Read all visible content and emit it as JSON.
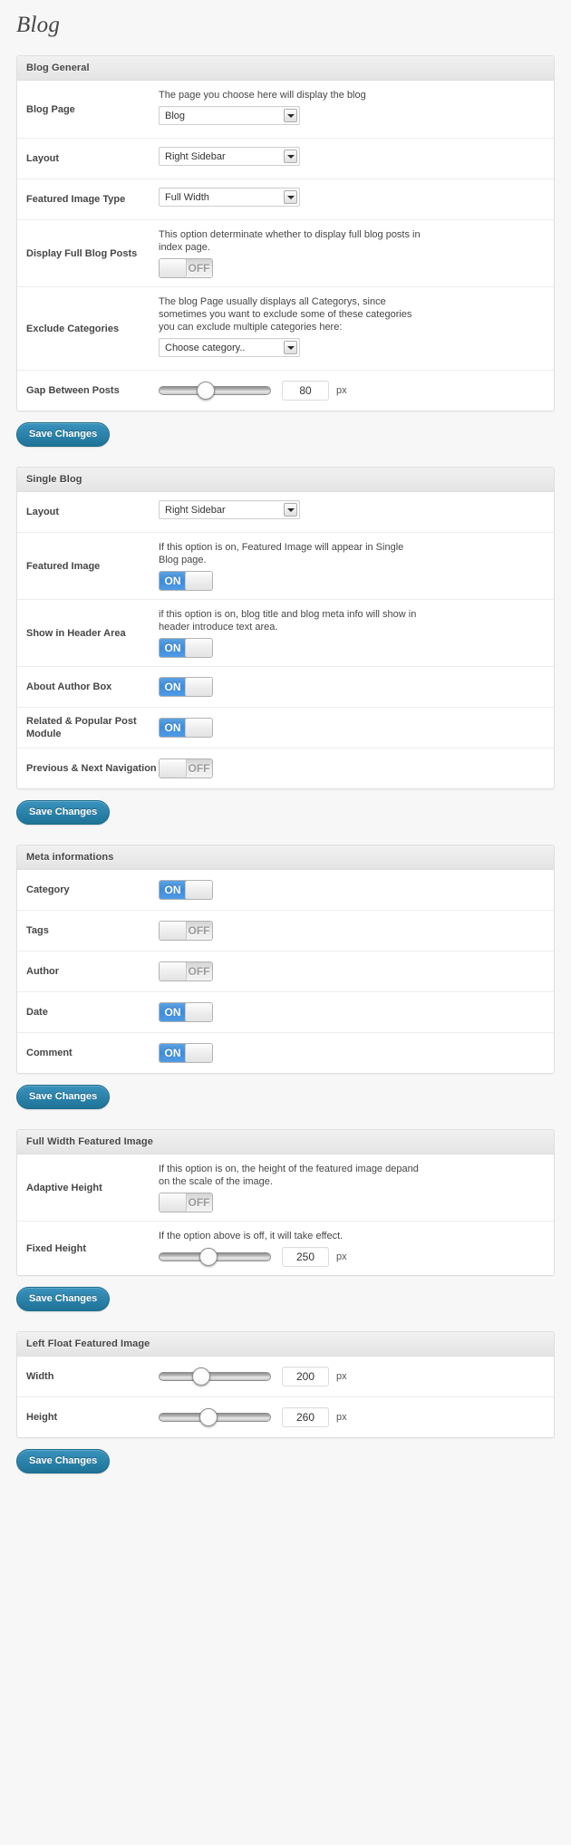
{
  "page": {
    "title": "Blog"
  },
  "save_label": "Save Changes",
  "units": {
    "px": "px"
  },
  "sections": [
    {
      "id": "blog-general",
      "header": "Blog General",
      "rows": [
        {
          "label": "Blog Page",
          "desc": "The page you choose here will display the blog",
          "control": "select",
          "value": "Blog"
        },
        {
          "label": "Layout",
          "desc": "",
          "control": "select",
          "value": "Right Sidebar"
        },
        {
          "label": "Featured Image Type",
          "desc": "",
          "control": "select",
          "value": "Full Width"
        },
        {
          "label": "Display Full Blog Posts",
          "desc": "This option determinate whether to display full blog posts in index page.",
          "control": "toggle",
          "state": "OFF"
        },
        {
          "label": "Exclude Categories",
          "desc": "The blog Page usually displays all Categorys, since sometimes you want to exclude some of these categories you can exclude multiple categories here:",
          "control": "select",
          "value": "Choose category.."
        },
        {
          "label": "Gap Between Posts",
          "desc": "",
          "control": "slider",
          "value": "80",
          "unit": "px",
          "percent": 42
        }
      ]
    },
    {
      "id": "single-blog",
      "header": "Single Blog",
      "rows": [
        {
          "label": "Layout",
          "desc": "",
          "control": "select",
          "value": "Right Sidebar"
        },
        {
          "label": "Featured Image",
          "desc": "If this option is on, Featured Image will appear in Single Blog page.",
          "control": "toggle",
          "state": "ON"
        },
        {
          "label": "Show in Header Area",
          "desc": "if this option is on, blog title and blog meta info will show in header introduce text area.",
          "control": "toggle",
          "state": "ON"
        },
        {
          "label": "About Author Box",
          "desc": "",
          "control": "toggle",
          "state": "ON"
        },
        {
          "label": "Related & Popular Post Module",
          "desc": "",
          "control": "toggle",
          "state": "ON"
        },
        {
          "label": "Previous & Next Navigation",
          "desc": "",
          "control": "toggle",
          "state": "OFF"
        }
      ]
    },
    {
      "id": "meta-informations",
      "header": "Meta informations",
      "rows": [
        {
          "label": "Category",
          "desc": "",
          "control": "toggle",
          "state": "ON"
        },
        {
          "label": "Tags",
          "desc": "",
          "control": "toggle",
          "state": "OFF"
        },
        {
          "label": "Author",
          "desc": "",
          "control": "toggle",
          "state": "OFF"
        },
        {
          "label": "Date",
          "desc": "",
          "control": "toggle",
          "state": "ON"
        },
        {
          "label": "Comment",
          "desc": "",
          "control": "toggle",
          "state": "ON"
        }
      ]
    },
    {
      "id": "full-width-featured-image",
      "header": "Full Width Featured Image",
      "rows": [
        {
          "label": "Adaptive Height",
          "desc": "If this option is on, the height of the featured image depand on the scale of the image.",
          "control": "toggle",
          "state": "OFF"
        },
        {
          "label": "Fixed Height",
          "desc": "If the option above is off, it will take effect.",
          "control": "slider",
          "value": "250",
          "unit": "px",
          "percent": 44
        }
      ]
    },
    {
      "id": "left-float-featured-image",
      "header": "Left Float Featured Image",
      "rows": [
        {
          "label": "Width",
          "desc": "",
          "control": "slider",
          "value": "200",
          "unit": "px",
          "percent": 38
        },
        {
          "label": "Height",
          "desc": "",
          "control": "slider",
          "value": "260",
          "unit": "px",
          "percent": 44
        }
      ]
    }
  ]
}
